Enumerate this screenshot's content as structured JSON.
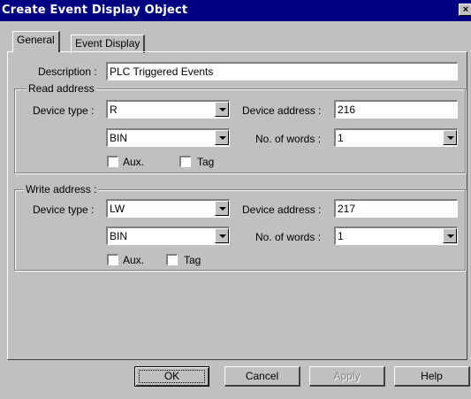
{
  "window": {
    "title": "Create Event Display  Object",
    "close_glyph": "×"
  },
  "tabs": [
    {
      "label": "General",
      "active": true
    },
    {
      "label": "Event Display",
      "active": false
    }
  ],
  "general": {
    "description_label": "Description :",
    "description_value": "PLC Triggered Events",
    "read": {
      "group_title": "Read address",
      "device_type_label": "Device type :",
      "device_type_value": "R",
      "format_value": "BIN",
      "device_address_label": "Device address :",
      "device_address_value": "216",
      "words_label": "No. of words :",
      "words_value": "1",
      "aux_label": "Aux.",
      "tag_label": "Tag"
    },
    "write": {
      "group_title": "Write address :",
      "device_type_label": "Device type :",
      "device_type_value": "LW",
      "format_value": "BIN",
      "device_address_label": "Device  address :",
      "device_address_value": "217",
      "words_label": "No. of words :",
      "words_value": "1",
      "aux_label": "Aux.",
      "tag_label": "Tag"
    }
  },
  "buttons": {
    "ok": "OK",
    "cancel": "Cancel",
    "apply": "Apply",
    "help": "Help"
  }
}
